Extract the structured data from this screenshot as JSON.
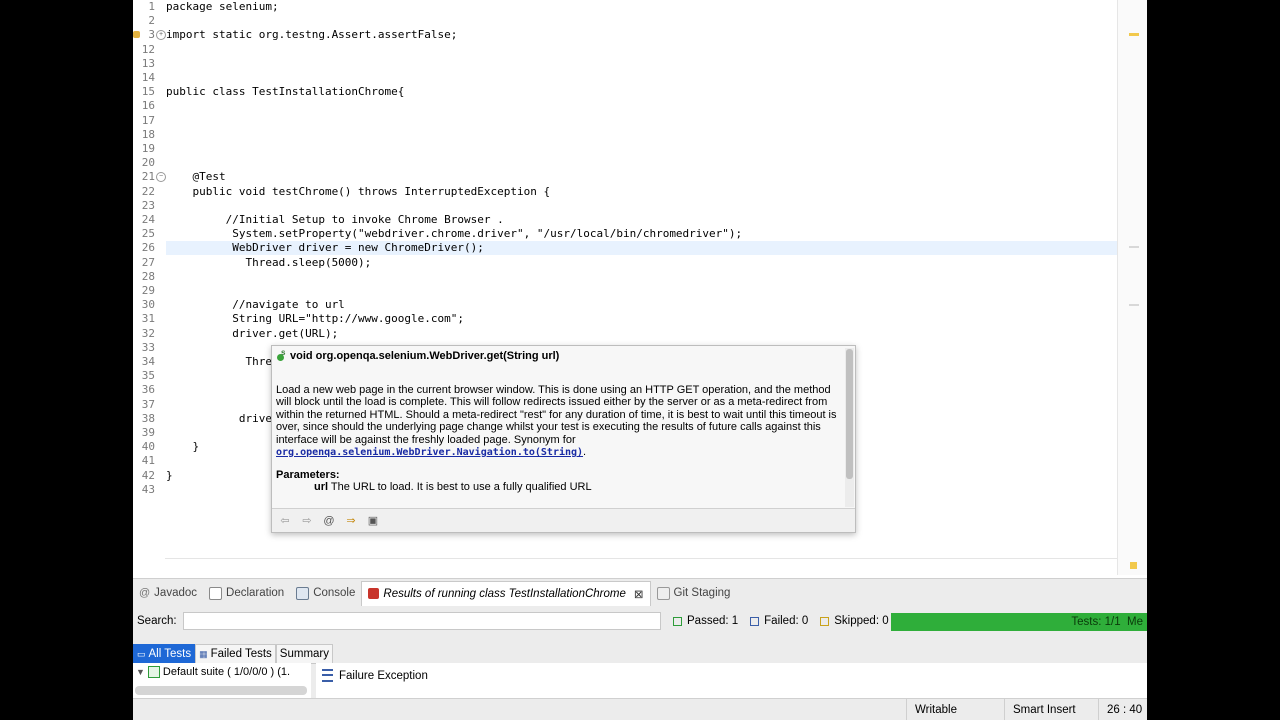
{
  "editor": {
    "lines": [
      {
        "num": "1",
        "text": "package selenium;"
      },
      {
        "num": "2",
        "text": ""
      },
      {
        "num": "3",
        "text": "import static org.testng.Assert.assertFalse;"
      },
      {
        "num": "12",
        "text": ""
      },
      {
        "num": "13",
        "text": ""
      },
      {
        "num": "14",
        "text": ""
      },
      {
        "num": "15",
        "text": "public class TestInstallationChrome{"
      },
      {
        "num": "16",
        "text": ""
      },
      {
        "num": "17",
        "text": ""
      },
      {
        "num": "18",
        "text": ""
      },
      {
        "num": "19",
        "text": ""
      },
      {
        "num": "20",
        "text": ""
      },
      {
        "num": "21",
        "text": "    @Test"
      },
      {
        "num": "22",
        "text": "    public void testChrome() throws InterruptedException {"
      },
      {
        "num": "23",
        "text": ""
      },
      {
        "num": "24",
        "text": "         //Initial Setup to invoke Chrome Browser ."
      },
      {
        "num": "25",
        "text": "          System.setProperty(\"webdriver.chrome.driver\", \"/usr/local/bin/chromedriver\");"
      },
      {
        "num": "26",
        "text": "          WebDriver driver = new ChromeDriver();"
      },
      {
        "num": "27",
        "text": "            Thread.sleep(5000);"
      },
      {
        "num": "28",
        "text": ""
      },
      {
        "num": "29",
        "text": ""
      },
      {
        "num": "30",
        "text": "          //navigate to url"
      },
      {
        "num": "31",
        "text": "          String URL=\"http://www.google.com\";"
      },
      {
        "num": "32",
        "text": "          driver.get(URL);"
      },
      {
        "num": "33",
        "text": ""
      },
      {
        "num": "34",
        "text": "            Threa"
      },
      {
        "num": "35",
        "text": ""
      },
      {
        "num": "36",
        "text": ""
      },
      {
        "num": "37",
        "text": ""
      },
      {
        "num": "38",
        "text": "           driver"
      },
      {
        "num": "39",
        "text": ""
      },
      {
        "num": "40",
        "text": "    }"
      },
      {
        "num": "41",
        "text": ""
      },
      {
        "num": "42",
        "text": "}"
      },
      {
        "num": "43",
        "text": ""
      }
    ],
    "current_line": "26"
  },
  "hover": {
    "signature": "void org.openqa.selenium.WebDriver.get(String url)",
    "description": "Load a new web page in the current browser window. This is done using an HTTP GET operation, and the method will block until the load is complete. This will follow redirects issued either by the server or as a meta-redirect from within the returned HTML. Should a meta-redirect \"rest\" for any duration of time, it is best to wait until this timeout is over, since should the underlying page change whilst your test is executing the results of future calls against this interface will be against the freshly loaded page. Synonym for",
    "link": "org.openqa.selenium.WebDriver.Navigation.to(String)",
    "link_suffix": ".",
    "params_title": "Parameters:",
    "param_name": "url",
    "param_desc": "The URL to load. It is best to use a fully qualified URL"
  },
  "panel": {
    "tabs": [
      "Javadoc",
      "Declaration",
      "Console",
      "Results of running class TestInstallationChrome",
      "Git Staging"
    ],
    "search_label": "Search:",
    "search_value": "",
    "passed": "Passed: 1",
    "failed": "Failed: 0",
    "skipped": "Skipped: 0",
    "progress_label": "Tests: 1/1",
    "progress_suffix": "Me",
    "progress_fraction": 1.0,
    "subtabs": [
      "All Tests",
      "Failed Tests",
      "Summary"
    ],
    "tree_item": "Default suite ( 1/0/0/0 ) (1.",
    "failure_label": "Failure Exception"
  },
  "status": {
    "writable": "Writable",
    "insert_mode": "Smart Insert",
    "position": "26 : 40"
  },
  "colors": {
    "progress_green": "#2fae3a",
    "selected_tab_blue": "#1e68d6",
    "link_blue": "#1a2ba4",
    "current_line_bg": "#e8f2fe"
  }
}
